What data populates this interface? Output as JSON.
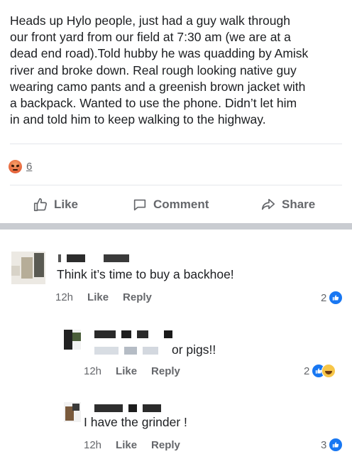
{
  "post": {
    "lines": [
      "Heads up Hylo people, just had a guy walk through",
      "our front yard from our field at 7:30 am (we are at a",
      "dead end road).Told hubby he was quadding by Amisk",
      "river and broke down. Real rough looking native guy",
      "wearing camo pants and a greenish brown jacket with",
      "a backpack. Wanted to use the phone. Didn’t let him",
      "in and told him to keep walking to the highway."
    ],
    "reaction_icon": "angry-icon",
    "reaction_count": "6"
  },
  "actions": {
    "like": "Like",
    "comment": "Comment",
    "share": "Share"
  },
  "comments": [
    {
      "text": "Think it’s time to buy a backhoe!",
      "time": "12h",
      "like": "Like",
      "reply": "Reply",
      "reaction_count": "2",
      "reaction_icons": [
        "like-icon"
      ]
    },
    {
      "text": "or pigs!!",
      "time": "12h",
      "like": "Like",
      "reply": "Reply",
      "reaction_count": "2",
      "reaction_icons": [
        "like-icon",
        "haha-icon"
      ]
    },
    {
      "text": "I have the grinder !",
      "time": "12h",
      "like": "Like",
      "reply": "Reply",
      "reaction_count": "3",
      "reaction_icons": [
        "like-icon"
      ]
    }
  ],
  "colors": {
    "text": "#1c1e21",
    "secondary": "#65676b",
    "like_blue": "#1877f2",
    "angry": "#e8673d",
    "separator": "#c9ccd1"
  }
}
